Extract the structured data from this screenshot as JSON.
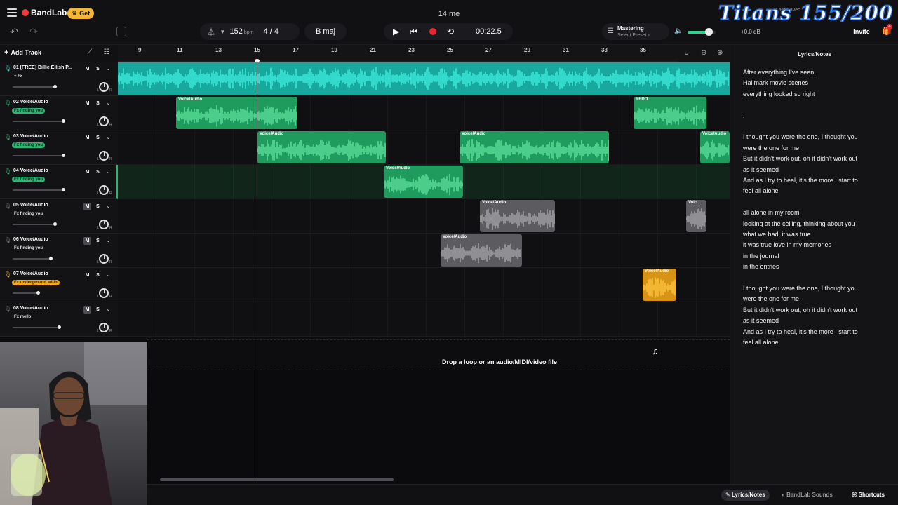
{
  "app": {
    "brand": "BandLab",
    "get_label": "Get",
    "project_title": "14 me",
    "last_saved": "Last Saved",
    "invite_label": "Invite",
    "gift_badge": "4",
    "watermark": "Titans 155/200"
  },
  "transport": {
    "bpm": "152",
    "bpm_unit": "bpm",
    "time_signature": "4 / 4",
    "key": "B maj",
    "time": "00:22.5",
    "mastering_label": "Mastering",
    "mastering_sub": "Select Preset",
    "master_volume_db": "+0.0 dB",
    "master_volume_level": 0.7
  },
  "toolbar": {
    "add_track": "Add Track"
  },
  "ruler": {
    "bars": [
      "9",
      "11",
      "13",
      "15",
      "17",
      "19",
      "21",
      "23",
      "25",
      "27",
      "29",
      "31",
      "33",
      "35"
    ]
  },
  "tracks": [
    {
      "label": "01  [FREE] Billie Eilish P...",
      "fx": "+ Fx",
      "fx_style": "plain",
      "solo_state": "off",
      "mute_state": "off",
      "volume": 0.5,
      "color": "#1fcfc1"
    },
    {
      "label": "02  Voice/Audio",
      "fx": "Fx finding you",
      "fx_style": "green",
      "solo_state": "off",
      "mute_state": "off",
      "volume": 0.6,
      "color": "#2bb673"
    },
    {
      "label": "03  Voice/Audio",
      "fx": "Fx finding you",
      "fx_style": "green",
      "solo_state": "off",
      "mute_state": "off",
      "volume": 0.6,
      "color": "#2bb673"
    },
    {
      "label": "04  Voice/Audio",
      "fx": "Fx finding you",
      "fx_style": "green",
      "solo_state": "off",
      "mute_state": "off",
      "volume": 0.6,
      "color": "#2bb673"
    },
    {
      "label": "05  Voice/Audio",
      "fx": "Fx finding you",
      "fx_style": "plain",
      "solo_state": "off",
      "mute_state": "on",
      "volume": 0.5,
      "color": "#7a7a7e"
    },
    {
      "label": "06  Voice/Audio",
      "fx": "Fx finding you",
      "fx_style": "plain",
      "solo_state": "off",
      "mute_state": "on",
      "volume": 0.45,
      "color": "#7a7a7e"
    },
    {
      "label": "07  Voice/Audio",
      "fx": "Fx underground adlib",
      "fx_style": "orange",
      "solo_state": "off",
      "mute_state": "off",
      "volume": 0.3,
      "color": "#f0a91c"
    },
    {
      "label": "08  Voice/Audio",
      "fx": "Fx mello",
      "fx_style": "plain",
      "solo_state": "off",
      "mute_state": "on",
      "volume": 0.55,
      "color": "#7a7a7e"
    }
  ],
  "track_buttons": {
    "mute": "M",
    "solo": "S",
    "left": "L",
    "right": "R"
  },
  "clip_labels": {
    "voice": "Voice/Audio",
    "voice_short": "Voic...",
    "redo": "REDO"
  },
  "drop_zone": {
    "text": "Drop a loop or an audio/MIDI/video file"
  },
  "side_panel": {
    "title": "Lyrics/Notes",
    "lines": [
      "After everything I've seen,",
      "Hallmark movie scenes",
      "everything looked so right",
      "",
      ".",
      "",
      "I thought you were the one, I thought you",
      "were the one for me",
      "But it didn't work out, oh it didn't work out",
      "as it seemed",
      "And as I try to heal, it's the more I start to",
      "feel all alone",
      "",
      "all alone in my room",
      "looking at the ceiling, thinking about you",
      "what we had, it was true",
      "it was true love in my memories",
      "in the journal",
      "in the entries",
      "",
      "I thought you were the one, I thought you",
      "were the one for me",
      "But it didn't work out, oh it didn't work out",
      "as it seemed",
      "And as I try to heal, it's the more I start to",
      "feel all alone"
    ]
  },
  "bottom_bar": {
    "lyrics_notes": "Lyrics/Notes",
    "bandlab_sounds": "BandLab Sounds",
    "shortcuts": "Shortcuts"
  },
  "colors": {
    "accent_green": "#2bb673",
    "teal": "#1fcfc1",
    "orange": "#f0a91c",
    "record_red": "#e8262e",
    "get_yellow": "#f5b731"
  }
}
